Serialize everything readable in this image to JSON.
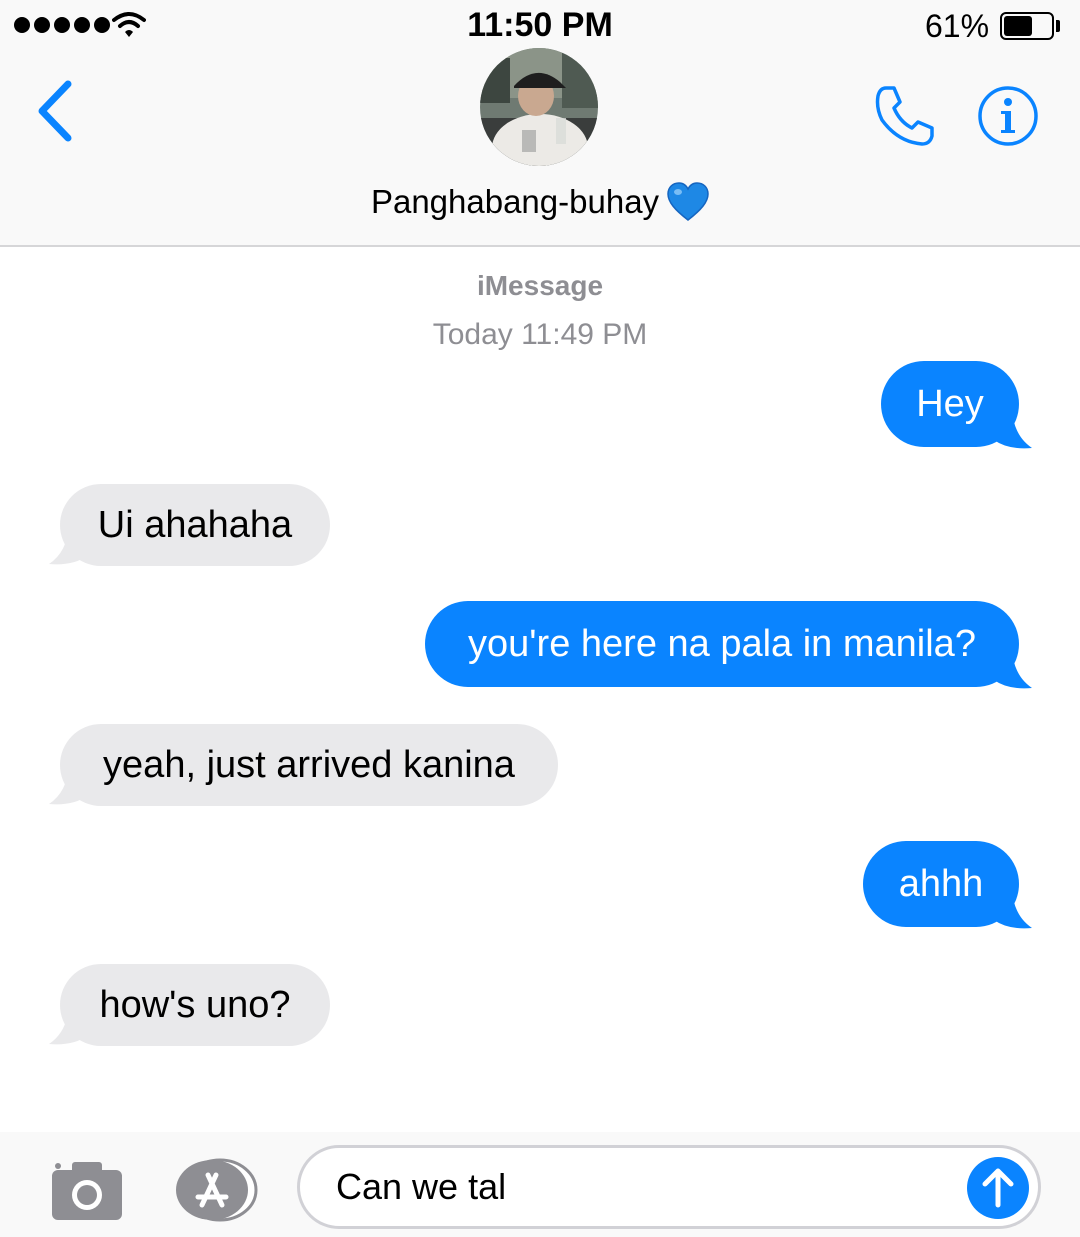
{
  "status_bar": {
    "time": "11:50 PM",
    "battery_percent": "61%",
    "battery_level": 0.61,
    "signal_bars": 5,
    "icons": [
      "signal-dots",
      "wifi-icon",
      "battery-icon"
    ]
  },
  "header": {
    "contact_name": "Panghabang-buhay",
    "contact_emoji_icon": "blue-heart-icon",
    "back_icon": "chevron-left-icon",
    "call_icon": "phone-icon",
    "info_icon": "info-icon",
    "accent_color": "#0a84ff"
  },
  "conversation": {
    "service_label": "iMessage",
    "timestamp": "Today 11:49 PM",
    "messages": [
      {
        "direction": "sent",
        "text": "Hey"
      },
      {
        "direction": "received",
        "text": "Ui ahahaha"
      },
      {
        "direction": "sent",
        "text": "you're here na pala in manila?"
      },
      {
        "direction": "received",
        "text": "yeah, just arrived kanina"
      },
      {
        "direction": "sent",
        "text": "ahhh"
      },
      {
        "direction": "received",
        "text": "how's uno?"
      }
    ],
    "sent_color": "#0a84ff",
    "received_color": "#e9e9eb"
  },
  "compose": {
    "value": "Can we tal",
    "camera_icon": "camera-icon",
    "apps_icon": "app-store-icon",
    "send_icon": "arrow-up-icon"
  }
}
